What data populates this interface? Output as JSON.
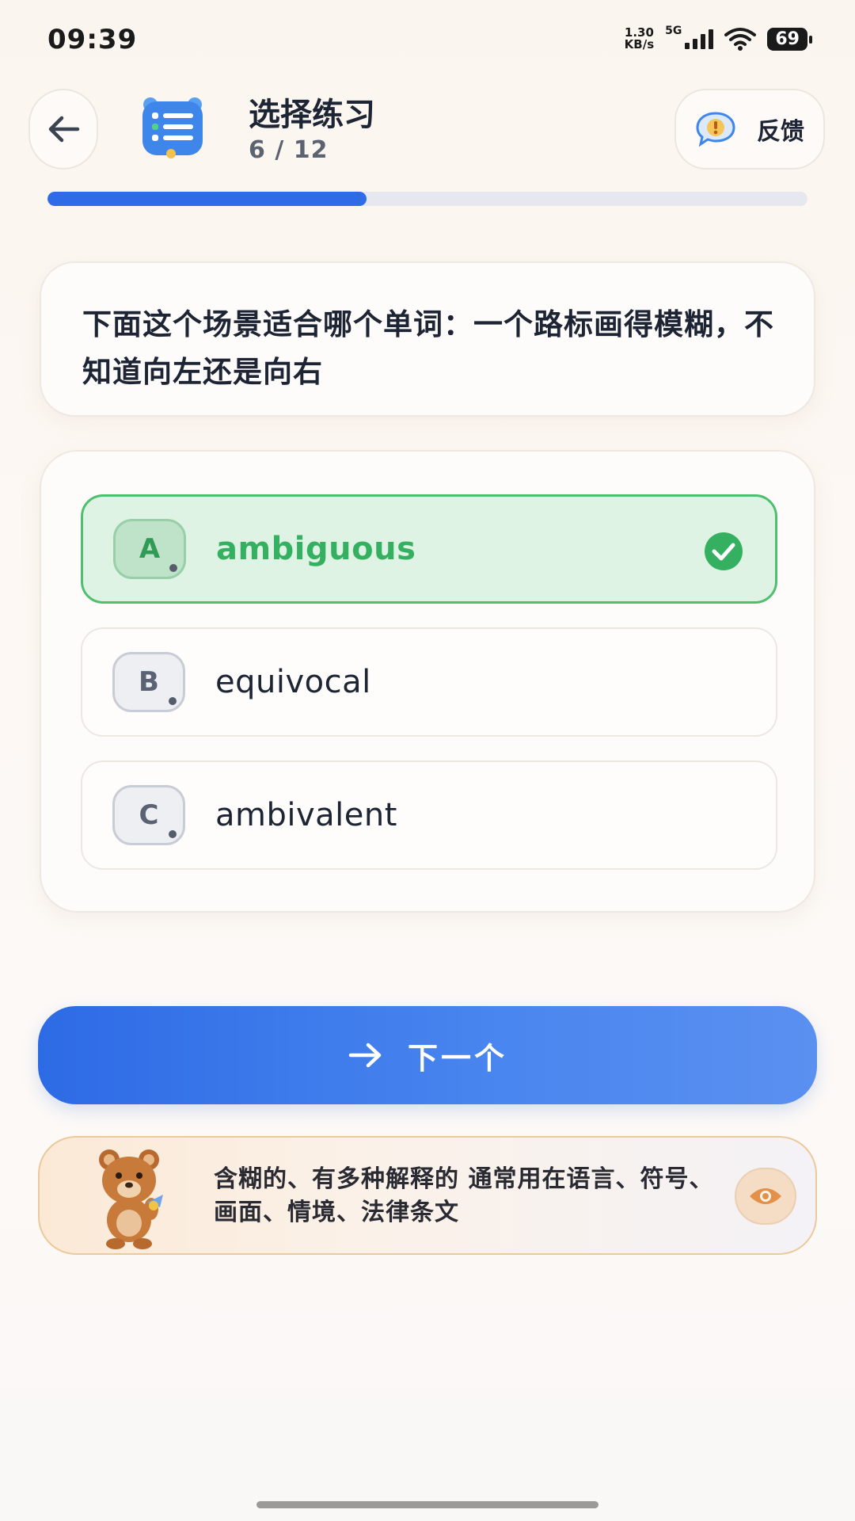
{
  "status_bar": {
    "time": "09:39",
    "net_speed_value": "1.30",
    "net_speed_unit": "KB/s",
    "network": "5G",
    "battery": "69",
    "icons": [
      "signal-icon",
      "wifi-icon",
      "battery-icon"
    ]
  },
  "header": {
    "title": "选择练习",
    "counter": "6 / 12",
    "feedback_label": "反馈",
    "icons": [
      "back-arrow-icon",
      "quiz-list-icon",
      "feedback-icon"
    ]
  },
  "progress": {
    "current": 6,
    "total": 12,
    "fraction": 0.42,
    "color": "#2f6be6"
  },
  "question": {
    "text": "下面这个场景适合哪个单词：一个路标画得模糊，不知道向左还是向右"
  },
  "options": [
    {
      "letter": "A",
      "text": "ambiguous",
      "state": "correct"
    },
    {
      "letter": "B",
      "text": "equivocal",
      "state": "default"
    },
    {
      "letter": "C",
      "text": "ambivalent",
      "state": "default"
    }
  ],
  "next_button": {
    "label": "下一个",
    "icon": "arrow-right-icon"
  },
  "hint": {
    "text": "含糊的、有多种解释的 通常用在语言、符号、画面、情境、法律条文",
    "icons": [
      "bear-mascot",
      "eye-icon"
    ]
  },
  "colors": {
    "accent": "#2f6be6",
    "correct": "#35b060",
    "correct_bg": "#dff3e5",
    "hint_border": "#ecc99a"
  }
}
